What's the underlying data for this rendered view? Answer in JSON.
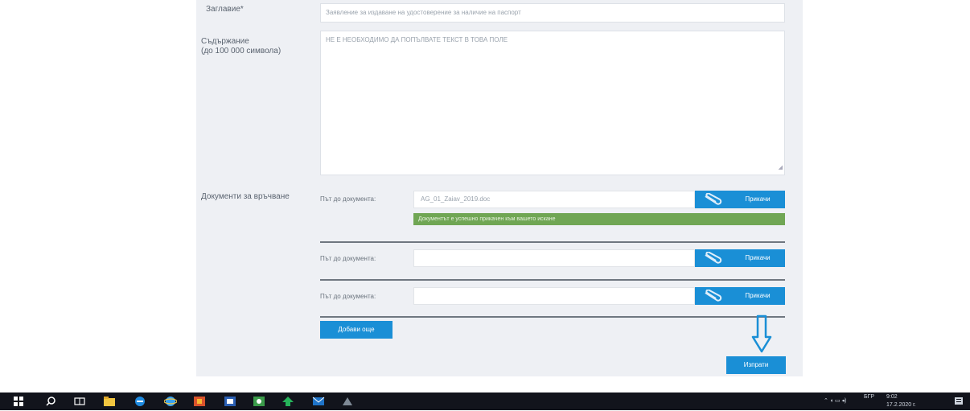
{
  "form": {
    "subject_label": "Заглавие*",
    "subject_value": "Заявление за издаване на удостоверение за наличие на паспорт",
    "content_label_line1": "Съдържание",
    "content_label_line2": "(до 100 000 символа)",
    "content_value": "НЕ Е НЕОБХОДИМО ДА ПОПЪЛВАТЕ ТЕКСТ В ТОВА ПОЛЕ",
    "attach_label": "Документи за връчване",
    "documents": [
      {
        "path_label": "Път до документа:",
        "value": "AG_01_Zaiav_2019.doc",
        "browse_label": "Прикачи"
      },
      {
        "path_label": "Път до документа:",
        "value": "",
        "browse_label": "Прикачи"
      },
      {
        "path_label": "Път до документа:",
        "value": "",
        "browse_label": "Прикачи"
      }
    ],
    "success_message": "Документът е успешно прикачен към вашето искане",
    "add_more_label": "Добави още",
    "submit_label": "Изпрати"
  },
  "taskbar": {
    "tray_lang": "БГР",
    "tray_time": "9:02",
    "tray_date": "17.2.2020 г."
  },
  "colors": {
    "accent": "#1a8fd6",
    "success": "#70a654",
    "panel": "#eef0f4",
    "taskbar": "#12141c"
  },
  "icons": [
    "paperclip-icon",
    "down-arrow-icon",
    "windows-start-icon",
    "search-icon",
    "task-view-icon",
    "file-explorer-icon",
    "edge-icon",
    "internet-explorer-icon",
    "app-icon",
    "word-icon",
    "app-icon",
    "app-icon",
    "mail-icon",
    "app-icon",
    "notification-icon"
  ]
}
